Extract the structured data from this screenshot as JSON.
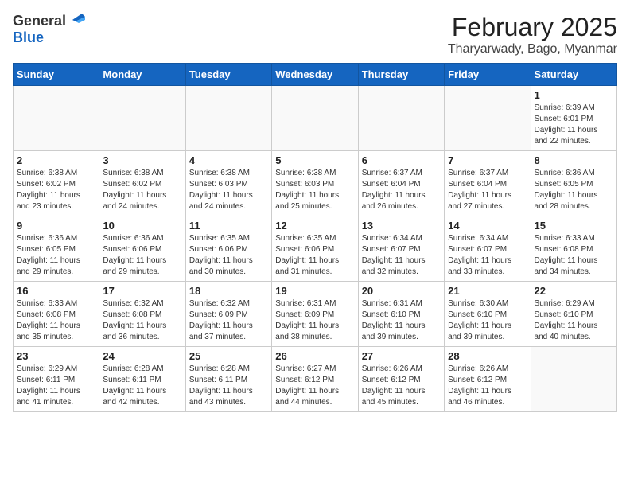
{
  "header": {
    "logo_general": "General",
    "logo_blue": "Blue",
    "month": "February 2025",
    "location": "Tharyarwady, Bago, Myanmar"
  },
  "weekdays": [
    "Sunday",
    "Monday",
    "Tuesday",
    "Wednesday",
    "Thursday",
    "Friday",
    "Saturday"
  ],
  "weeks": [
    [
      {
        "day": "",
        "info": ""
      },
      {
        "day": "",
        "info": ""
      },
      {
        "day": "",
        "info": ""
      },
      {
        "day": "",
        "info": ""
      },
      {
        "day": "",
        "info": ""
      },
      {
        "day": "",
        "info": ""
      },
      {
        "day": "1",
        "info": "Sunrise: 6:39 AM\nSunset: 6:01 PM\nDaylight: 11 hours\nand 22 minutes."
      }
    ],
    [
      {
        "day": "2",
        "info": "Sunrise: 6:38 AM\nSunset: 6:02 PM\nDaylight: 11 hours\nand 23 minutes."
      },
      {
        "day": "3",
        "info": "Sunrise: 6:38 AM\nSunset: 6:02 PM\nDaylight: 11 hours\nand 24 minutes."
      },
      {
        "day": "4",
        "info": "Sunrise: 6:38 AM\nSunset: 6:03 PM\nDaylight: 11 hours\nand 24 minutes."
      },
      {
        "day": "5",
        "info": "Sunrise: 6:38 AM\nSunset: 6:03 PM\nDaylight: 11 hours\nand 25 minutes."
      },
      {
        "day": "6",
        "info": "Sunrise: 6:37 AM\nSunset: 6:04 PM\nDaylight: 11 hours\nand 26 minutes."
      },
      {
        "day": "7",
        "info": "Sunrise: 6:37 AM\nSunset: 6:04 PM\nDaylight: 11 hours\nand 27 minutes."
      },
      {
        "day": "8",
        "info": "Sunrise: 6:36 AM\nSunset: 6:05 PM\nDaylight: 11 hours\nand 28 minutes."
      }
    ],
    [
      {
        "day": "9",
        "info": "Sunrise: 6:36 AM\nSunset: 6:05 PM\nDaylight: 11 hours\nand 29 minutes."
      },
      {
        "day": "10",
        "info": "Sunrise: 6:36 AM\nSunset: 6:06 PM\nDaylight: 11 hours\nand 29 minutes."
      },
      {
        "day": "11",
        "info": "Sunrise: 6:35 AM\nSunset: 6:06 PM\nDaylight: 11 hours\nand 30 minutes."
      },
      {
        "day": "12",
        "info": "Sunrise: 6:35 AM\nSunset: 6:06 PM\nDaylight: 11 hours\nand 31 minutes."
      },
      {
        "day": "13",
        "info": "Sunrise: 6:34 AM\nSunset: 6:07 PM\nDaylight: 11 hours\nand 32 minutes."
      },
      {
        "day": "14",
        "info": "Sunrise: 6:34 AM\nSunset: 6:07 PM\nDaylight: 11 hours\nand 33 minutes."
      },
      {
        "day": "15",
        "info": "Sunrise: 6:33 AM\nSunset: 6:08 PM\nDaylight: 11 hours\nand 34 minutes."
      }
    ],
    [
      {
        "day": "16",
        "info": "Sunrise: 6:33 AM\nSunset: 6:08 PM\nDaylight: 11 hours\nand 35 minutes."
      },
      {
        "day": "17",
        "info": "Sunrise: 6:32 AM\nSunset: 6:08 PM\nDaylight: 11 hours\nand 36 minutes."
      },
      {
        "day": "18",
        "info": "Sunrise: 6:32 AM\nSunset: 6:09 PM\nDaylight: 11 hours\nand 37 minutes."
      },
      {
        "day": "19",
        "info": "Sunrise: 6:31 AM\nSunset: 6:09 PM\nDaylight: 11 hours\nand 38 minutes."
      },
      {
        "day": "20",
        "info": "Sunrise: 6:31 AM\nSunset: 6:10 PM\nDaylight: 11 hours\nand 39 minutes."
      },
      {
        "day": "21",
        "info": "Sunrise: 6:30 AM\nSunset: 6:10 PM\nDaylight: 11 hours\nand 39 minutes."
      },
      {
        "day": "22",
        "info": "Sunrise: 6:29 AM\nSunset: 6:10 PM\nDaylight: 11 hours\nand 40 minutes."
      }
    ],
    [
      {
        "day": "23",
        "info": "Sunrise: 6:29 AM\nSunset: 6:11 PM\nDaylight: 11 hours\nand 41 minutes."
      },
      {
        "day": "24",
        "info": "Sunrise: 6:28 AM\nSunset: 6:11 PM\nDaylight: 11 hours\nand 42 minutes."
      },
      {
        "day": "25",
        "info": "Sunrise: 6:28 AM\nSunset: 6:11 PM\nDaylight: 11 hours\nand 43 minutes."
      },
      {
        "day": "26",
        "info": "Sunrise: 6:27 AM\nSunset: 6:12 PM\nDaylight: 11 hours\nand 44 minutes."
      },
      {
        "day": "27",
        "info": "Sunrise: 6:26 AM\nSunset: 6:12 PM\nDaylight: 11 hours\nand 45 minutes."
      },
      {
        "day": "28",
        "info": "Sunrise: 6:26 AM\nSunset: 6:12 PM\nDaylight: 11 hours\nand 46 minutes."
      },
      {
        "day": "",
        "info": ""
      }
    ]
  ]
}
